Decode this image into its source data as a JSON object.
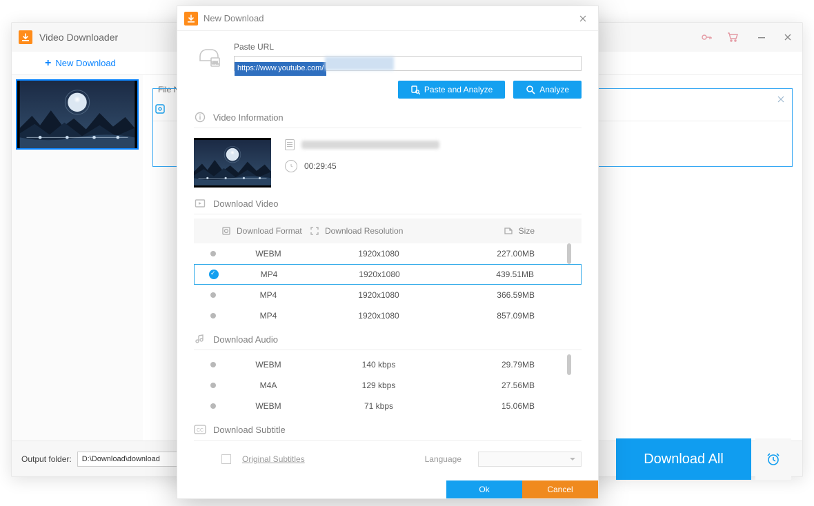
{
  "app": {
    "title": "Video Downloader"
  },
  "toolbar": {
    "new_download": "New Download"
  },
  "queue": {
    "file_label": "File N"
  },
  "bottom": {
    "output_label": "Output folder:",
    "output_path": "D:\\Download\\download",
    "download_all": "Download All"
  },
  "modal": {
    "title": "New Download",
    "paste_label": "Paste URL",
    "url_visible": "https://www.youtube.com/",
    "paste_analyze": "Paste and Analyze",
    "analyze": "Analyze",
    "video_info": "Video Information",
    "duration": "00:29:45",
    "download_video": "Download Video",
    "download_audio": "Download Audio",
    "download_subtitle": "Download Subtitle",
    "col_format": "Download Format",
    "col_resolution": "Download Resolution",
    "col_size": "Size",
    "video_rows": [
      {
        "format": "WEBM",
        "res": "1920x1080",
        "size": "227.00MB",
        "selected": false
      },
      {
        "format": "MP4",
        "res": "1920x1080",
        "size": "439.51MB",
        "selected": true
      },
      {
        "format": "MP4",
        "res": "1920x1080",
        "size": "366.59MB",
        "selected": false
      },
      {
        "format": "MP4",
        "res": "1920x1080",
        "size": "857.09MB",
        "selected": false
      }
    ],
    "audio_rows": [
      {
        "format": "WEBM",
        "res": "140 kbps",
        "size": "29.79MB"
      },
      {
        "format": "M4A",
        "res": "129 kbps",
        "size": "27.56MB"
      },
      {
        "format": "WEBM",
        "res": "71 kbps",
        "size": "15.06MB"
      }
    ],
    "original_subtitles": "Original Subtitles",
    "language": "Language",
    "ok": "Ok",
    "cancel": "Cancel"
  }
}
